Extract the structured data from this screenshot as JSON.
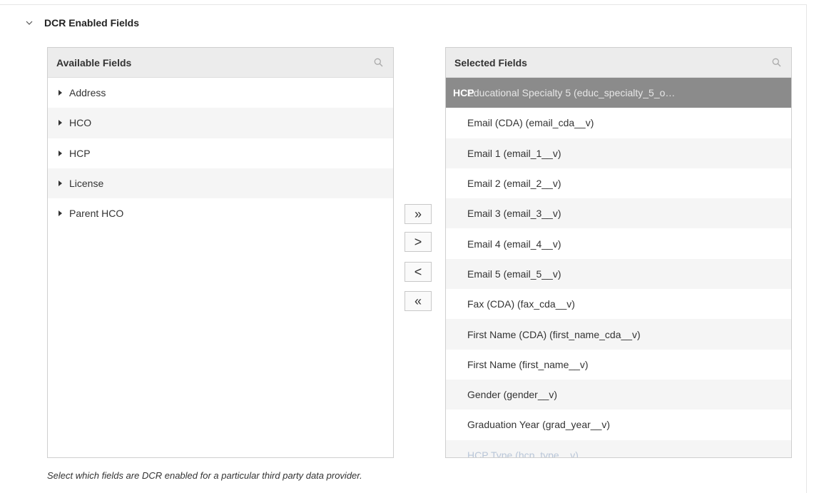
{
  "section": {
    "title": "DCR Enabled Fields",
    "icon": "chevron-down-icon"
  },
  "available": {
    "title": "Available Fields",
    "search_icon": "search-icon",
    "items": [
      {
        "label": "Address"
      },
      {
        "label": "HCO"
      },
      {
        "label": "HCP"
      },
      {
        "label": "License"
      },
      {
        "label": "Parent HCO"
      }
    ]
  },
  "selected": {
    "title": "Selected Fields",
    "search_icon": "search-icon",
    "highlighted_prefix": "HCP",
    "highlighted_text": "Educational Specialty 5 (educ_specialty_5_o…",
    "items": [
      {
        "label": "Email (CDA) (email_cda__v)"
      },
      {
        "label": "Email 1 (email_1__v)"
      },
      {
        "label": "Email 2 (email_2__v)"
      },
      {
        "label": "Email 3 (email_3__v)"
      },
      {
        "label": "Email 4 (email_4__v)"
      },
      {
        "label": "Email 5 (email_5__v)"
      },
      {
        "label": "Fax (CDA) (fax_cda__v)"
      },
      {
        "label": "First Name (CDA) (first_name_cda__v)"
      },
      {
        "label": "First Name (first_name__v)"
      },
      {
        "label": "Gender (gender__v)"
      },
      {
        "label": "Graduation Year (grad_year__v)"
      },
      {
        "label": "HCP Type (hcp_type__v)"
      }
    ]
  },
  "movers": {
    "add_all": "»",
    "add_one": ">",
    "remove_one": "<",
    "remove_all": "«"
  },
  "hint": "Select which fields are DCR enabled for a particular third party data provider.",
  "colors": {
    "selected_row": "#8b8b8b",
    "header_bg": "#ececec",
    "faded_text": "#b9c6d8"
  }
}
